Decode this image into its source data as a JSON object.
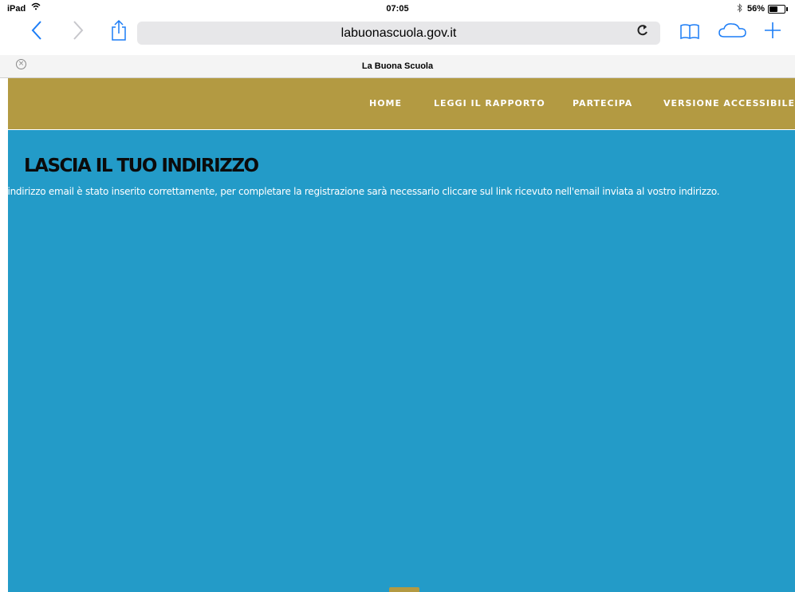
{
  "status_bar": {
    "device": "iPad",
    "time": "07:05",
    "battery": "56%",
    "battery_level": 0.56
  },
  "toolbar": {
    "url": "labuonascuola.gov.it"
  },
  "tab": {
    "title": "La Buona Scuola"
  },
  "site_nav": {
    "items": [
      {
        "label": "HOME"
      },
      {
        "label": "LEGGI IL RAPPORTO"
      },
      {
        "label": "PARTECIPA"
      },
      {
        "label": "VERSIONE ACCESSIBILE"
      }
    ]
  },
  "main": {
    "heading": "LASCIA IL TUO INDIRIZZO",
    "message": "L'indirizzo email è stato inserito correttamente, per completare la registrazione sarà necessario cliccare sul link ricevuto nell'email inviata al vostro indirizzo."
  },
  "colors": {
    "nav_background": "#b39a42",
    "main_background": "#239bc8",
    "browser_accent": "#1c7df6"
  },
  "icons": [
    "wifi-icon",
    "bluetooth-icon",
    "battery-icon",
    "back-icon",
    "forward-icon",
    "share-icon",
    "reload-icon",
    "bookmarks-icon",
    "icloud-tabs-icon",
    "new-tab-icon",
    "close-tab-icon"
  ]
}
